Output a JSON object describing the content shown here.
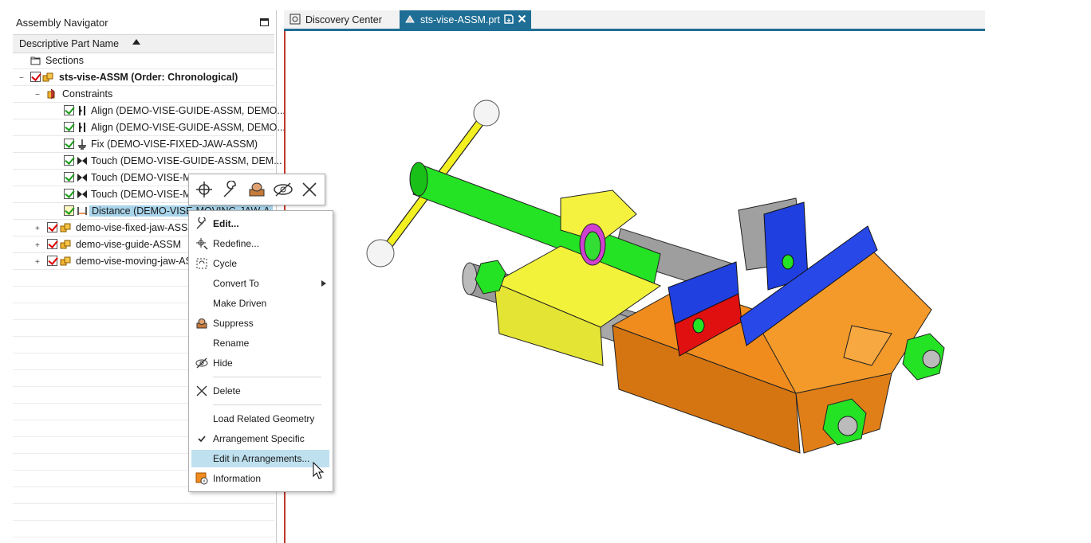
{
  "navigator": {
    "title": "Assembly Navigator",
    "column_header": "Descriptive Part Name",
    "rows": [
      {
        "label": "Sections"
      },
      {
        "label": "sts-vise-ASSM (Order: Chronological)"
      },
      {
        "label": "Constraints"
      },
      {
        "label": "Align (DEMO-VISE-GUIDE-ASSM, DEMO..."
      },
      {
        "label": "Align (DEMO-VISE-GUIDE-ASSM, DEMO..."
      },
      {
        "label": "Fix (DEMO-VISE-FIXED-JAW-ASSM)"
      },
      {
        "label": "Touch (DEMO-VISE-GUIDE-ASSM, DEM..."
      },
      {
        "label": "Touch (DEMO-VISE-MOVING-JAW-ASS"
      },
      {
        "label": "Touch (DEMO-VISE-MOVING-JAW-ASS"
      },
      {
        "label": "Distance (DEMO-VISE-MOVING-JAW-A"
      },
      {
        "label": "demo-vise-fixed-jaw-ASSM"
      },
      {
        "label": "demo-vise-guide-ASSM"
      },
      {
        "label": "demo-vise-moving-jaw-ASSM"
      }
    ]
  },
  "tabs": [
    {
      "label": "Discovery Center"
    },
    {
      "label": "sts-vise-ASSM.prt"
    }
  ],
  "context_menu": {
    "items": [
      {
        "label": "Edit..."
      },
      {
        "label": "Redefine..."
      },
      {
        "label": "Cycle"
      },
      {
        "label": "Convert To"
      },
      {
        "label": "Make Driven"
      },
      {
        "label": "Suppress"
      },
      {
        "label": "Rename"
      },
      {
        "label": "Hide"
      },
      {
        "label": "Delete"
      },
      {
        "label": "Load Related Geometry"
      },
      {
        "label": "Arrangement Specific"
      },
      {
        "label": "Edit in Arrangements..."
      },
      {
        "label": "Information"
      }
    ]
  },
  "colors": {
    "accent": "#1f6e95",
    "selection": "#bfe0ef",
    "tree_highlight": "#a8d4ea",
    "viewport_border": "#c0392b"
  }
}
